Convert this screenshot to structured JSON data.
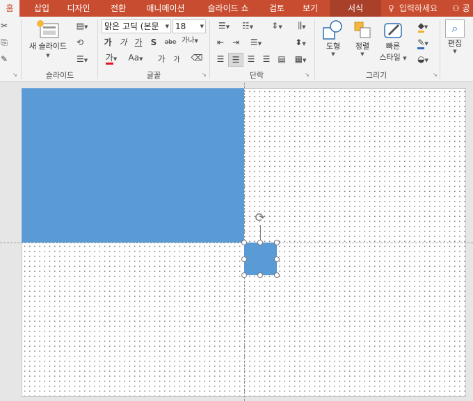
{
  "tabs": [
    {
      "label": "홈",
      "active": true
    },
    {
      "label": "삽입"
    },
    {
      "label": "디자인"
    },
    {
      "label": "전환"
    },
    {
      "label": "애니메이션"
    },
    {
      "label": "슬라이드 쇼"
    },
    {
      "label": "검토"
    },
    {
      "label": "보기"
    },
    {
      "label": "서식",
      "context": true
    }
  ],
  "tellme": {
    "label": "입력하세요"
  },
  "share": {
    "label": "공"
  },
  "slides_group": {
    "new_slide_label": "새 슬라이드",
    "group_label": "슬라이드"
  },
  "font_group": {
    "font_name": "맑은 고딕 (본문",
    "font_size": "18",
    "group_label": "글꼴",
    "bold": "가",
    "italic": "가",
    "underline": "가",
    "shadow": "S",
    "strike": "abe",
    "spacing": "가나",
    "font_color": "가",
    "change_case": "Aa",
    "grow": "가",
    "shrink": "가"
  },
  "paragraph_group": {
    "group_label": "단락"
  },
  "drawing_group": {
    "shapes_label": "도형",
    "arrange_label": "정렬",
    "quick_styles_line1": "빠른",
    "quick_styles_line2": "스타일",
    "group_label": "그리기"
  },
  "editing_group": {
    "label": "편집"
  },
  "colors": {
    "tab_bar": "#c84d30",
    "shape_fill": "#5b9bd5",
    "font_color_underline": "#e81123",
    "fill_color_underline": "#f3b12a",
    "outline_color_underline": "#2e6db4"
  }
}
